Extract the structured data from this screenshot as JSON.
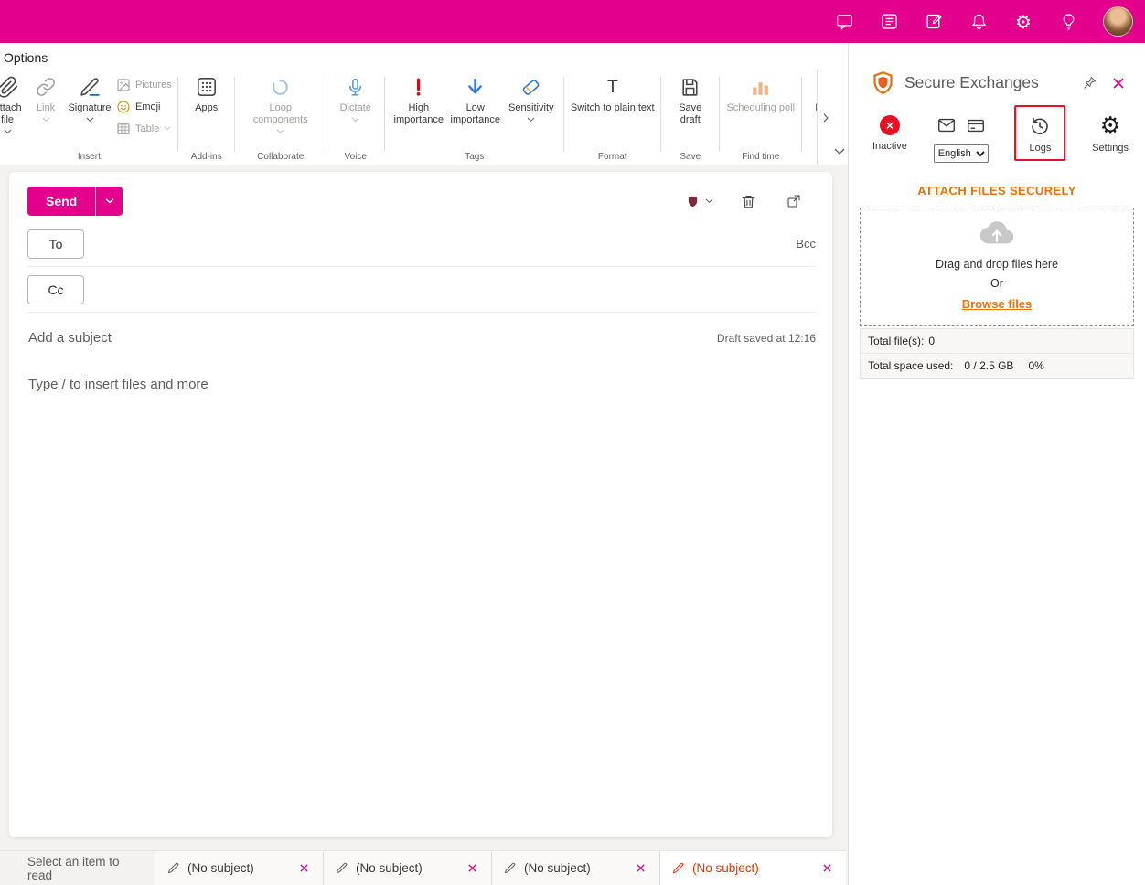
{
  "colors": {
    "theme_pink": "#e3008c",
    "accent_orange": "#e8710a",
    "active_tab_orange": "#d83b01",
    "highlight_red": "#e81123"
  },
  "icons": {
    "topbar": [
      "chat-icon",
      "feed-icon",
      "notes-icon",
      "notifications-bell-icon",
      "settings-gear-icon",
      "tips-lightbulb-icon",
      "profile-avatar"
    ],
    "ribbon": [
      "paperclip-icon",
      "link-icon",
      "signature-icon",
      "image-icon",
      "emoji-icon",
      "table-icon",
      "apps-grid-icon",
      "loop-icon",
      "microphone-icon",
      "exclamation-icon",
      "down-arrow-icon",
      "sensitivity-icon",
      "text-t-icon",
      "floppy-icon",
      "poll-bars-icon",
      "pencil-icon",
      "chevron-down-icon",
      "chevron-right-icon"
    ],
    "compose": [
      "encryption-shield-icon",
      "trash-icon",
      "popout-icon"
    ],
    "panel": [
      "shield-logo-icon",
      "pin-icon",
      "close-icon",
      "inactive-status-icon",
      "envelope-icon",
      "credit-card-icon",
      "history-icon",
      "gear-icon",
      "cloud-upload-icon"
    ],
    "tabbar": [
      "pencil-icon",
      "close-tab-icon"
    ]
  },
  "ribbon": {
    "active_tab": "Options",
    "groups": {
      "insert": {
        "label": "Insert",
        "attach": "Attach file",
        "link": "Link",
        "signature": "Signature",
        "pictures": "Pictures",
        "emoji": "Emoji",
        "table": "Table"
      },
      "addins": {
        "label": "Add-ins",
        "apps": "Apps"
      },
      "collaborate": {
        "label": "Collaborate",
        "loop": "Loop components"
      },
      "voice": {
        "label": "Voice",
        "dictate": "Dictate"
      },
      "tags": {
        "label": "Tags",
        "high": "High importance",
        "low": "Low importance",
        "sensitivity": "Sensitivity"
      },
      "format": {
        "label": "Format",
        "plain": "Switch to plain text"
      },
      "save": {
        "label": "Save",
        "save_draft": "Save draft"
      },
      "findtime": {
        "label": "Find time",
        "poll": "Scheduling poll"
      },
      "editor": {
        "editor": "Editor"
      }
    }
  },
  "compose": {
    "send_label": "Send",
    "to_label": "To",
    "cc_label": "Cc",
    "bcc_label": "Bcc",
    "subject_placeholder": "Add a subject",
    "draft_status": "Draft saved at 12:16",
    "body_placeholder": "Type / to insert files and more"
  },
  "panel": {
    "title": "Secure Exchanges",
    "status_label": "Inactive",
    "language_selected": "English",
    "logs_label": "Logs",
    "settings_label": "Settings",
    "attach_heading": "ATTACH FILES SECURELY",
    "dropzone_line1": "Drag and drop files here",
    "dropzone_or": "Or",
    "browse_link": "Browse files",
    "totals": {
      "files_label": "Total file(s):",
      "files_value": "0",
      "space_label": "Total space used:",
      "space_value": "0 / 2.5 GB",
      "space_percent": "0%"
    }
  },
  "tabbar": {
    "reading_pane_label": "Select an item to read",
    "tabs": [
      {
        "label": "(No subject)"
      },
      {
        "label": "(No subject)"
      },
      {
        "label": "(No subject)"
      },
      {
        "label": "(No subject)",
        "active": true
      }
    ]
  }
}
